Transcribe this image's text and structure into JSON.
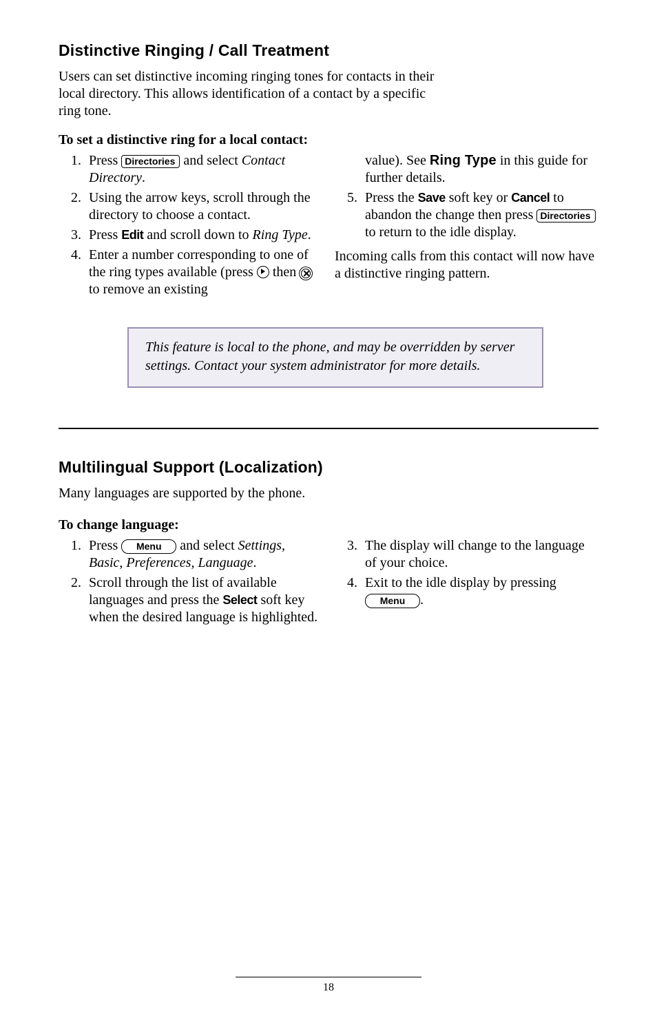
{
  "section1": {
    "heading": "Distinctive Ringing / Call Treatment",
    "intro": "Users can set distinctive incoming ringing tones for contacts in their local directory.  This allows identification of a contact by a specific ring tone.",
    "subheading": "To set a distinctive ring for a local contact:",
    "keys": {
      "directories": "Directories",
      "edit": "Edit",
      "save": "Save",
      "cancel": "Cancel"
    },
    "heavy": {
      "ringType": "Ring Type"
    },
    "left": {
      "s1a": "Press ",
      "s1b": " and select ",
      "s1c_ital": "Contact Directory",
      "s1d": ".",
      "s2": "Using the arrow keys, scroll through the directory to choose a contact.",
      "s3a": "Press ",
      "s3b": " and scroll down to ",
      "s3c_ital": "Ring Type",
      "s3d": ".",
      "s4a": "Enter a number corresponding to one of the ring types available (press ",
      "s4b": " then ",
      "s4c": " to remove an existing"
    },
    "right": {
      "s4cont_a": "value).  See ",
      "s4cont_b": " in this guide for further details.",
      "s5a": "Press the ",
      "s5b": " soft key or ",
      "s5c": " to abandon the change then press ",
      "s5d": " to return to the idle display."
    },
    "incoming": "Incoming calls from this contact will now have a distinctive ringing pattern.",
    "note": "This feature is local to the phone, and may be overridden by server settings.  Contact your system administrator for more details."
  },
  "section2": {
    "heading": "Multilingual Support (Localization)",
    "intro": "Many languages are supported by the phone.",
    "subheading": "To change language:",
    "keys": {
      "menu": "Menu",
      "select": "Select"
    },
    "left": {
      "s1a": "Press ",
      "s1b": " and select ",
      "s1c_ital": "Settings, Basic, Preferences, Language",
      "s1d": ".",
      "s2a": "Scroll through the list of available languages and press the ",
      "s2b": " soft key when the desired language is highlighted."
    },
    "right": {
      "s3": "The display will change to the language of your choice.",
      "s4a": "Exit to the idle display by pressing ",
      "s4b": "."
    }
  },
  "pageNumber": "18"
}
